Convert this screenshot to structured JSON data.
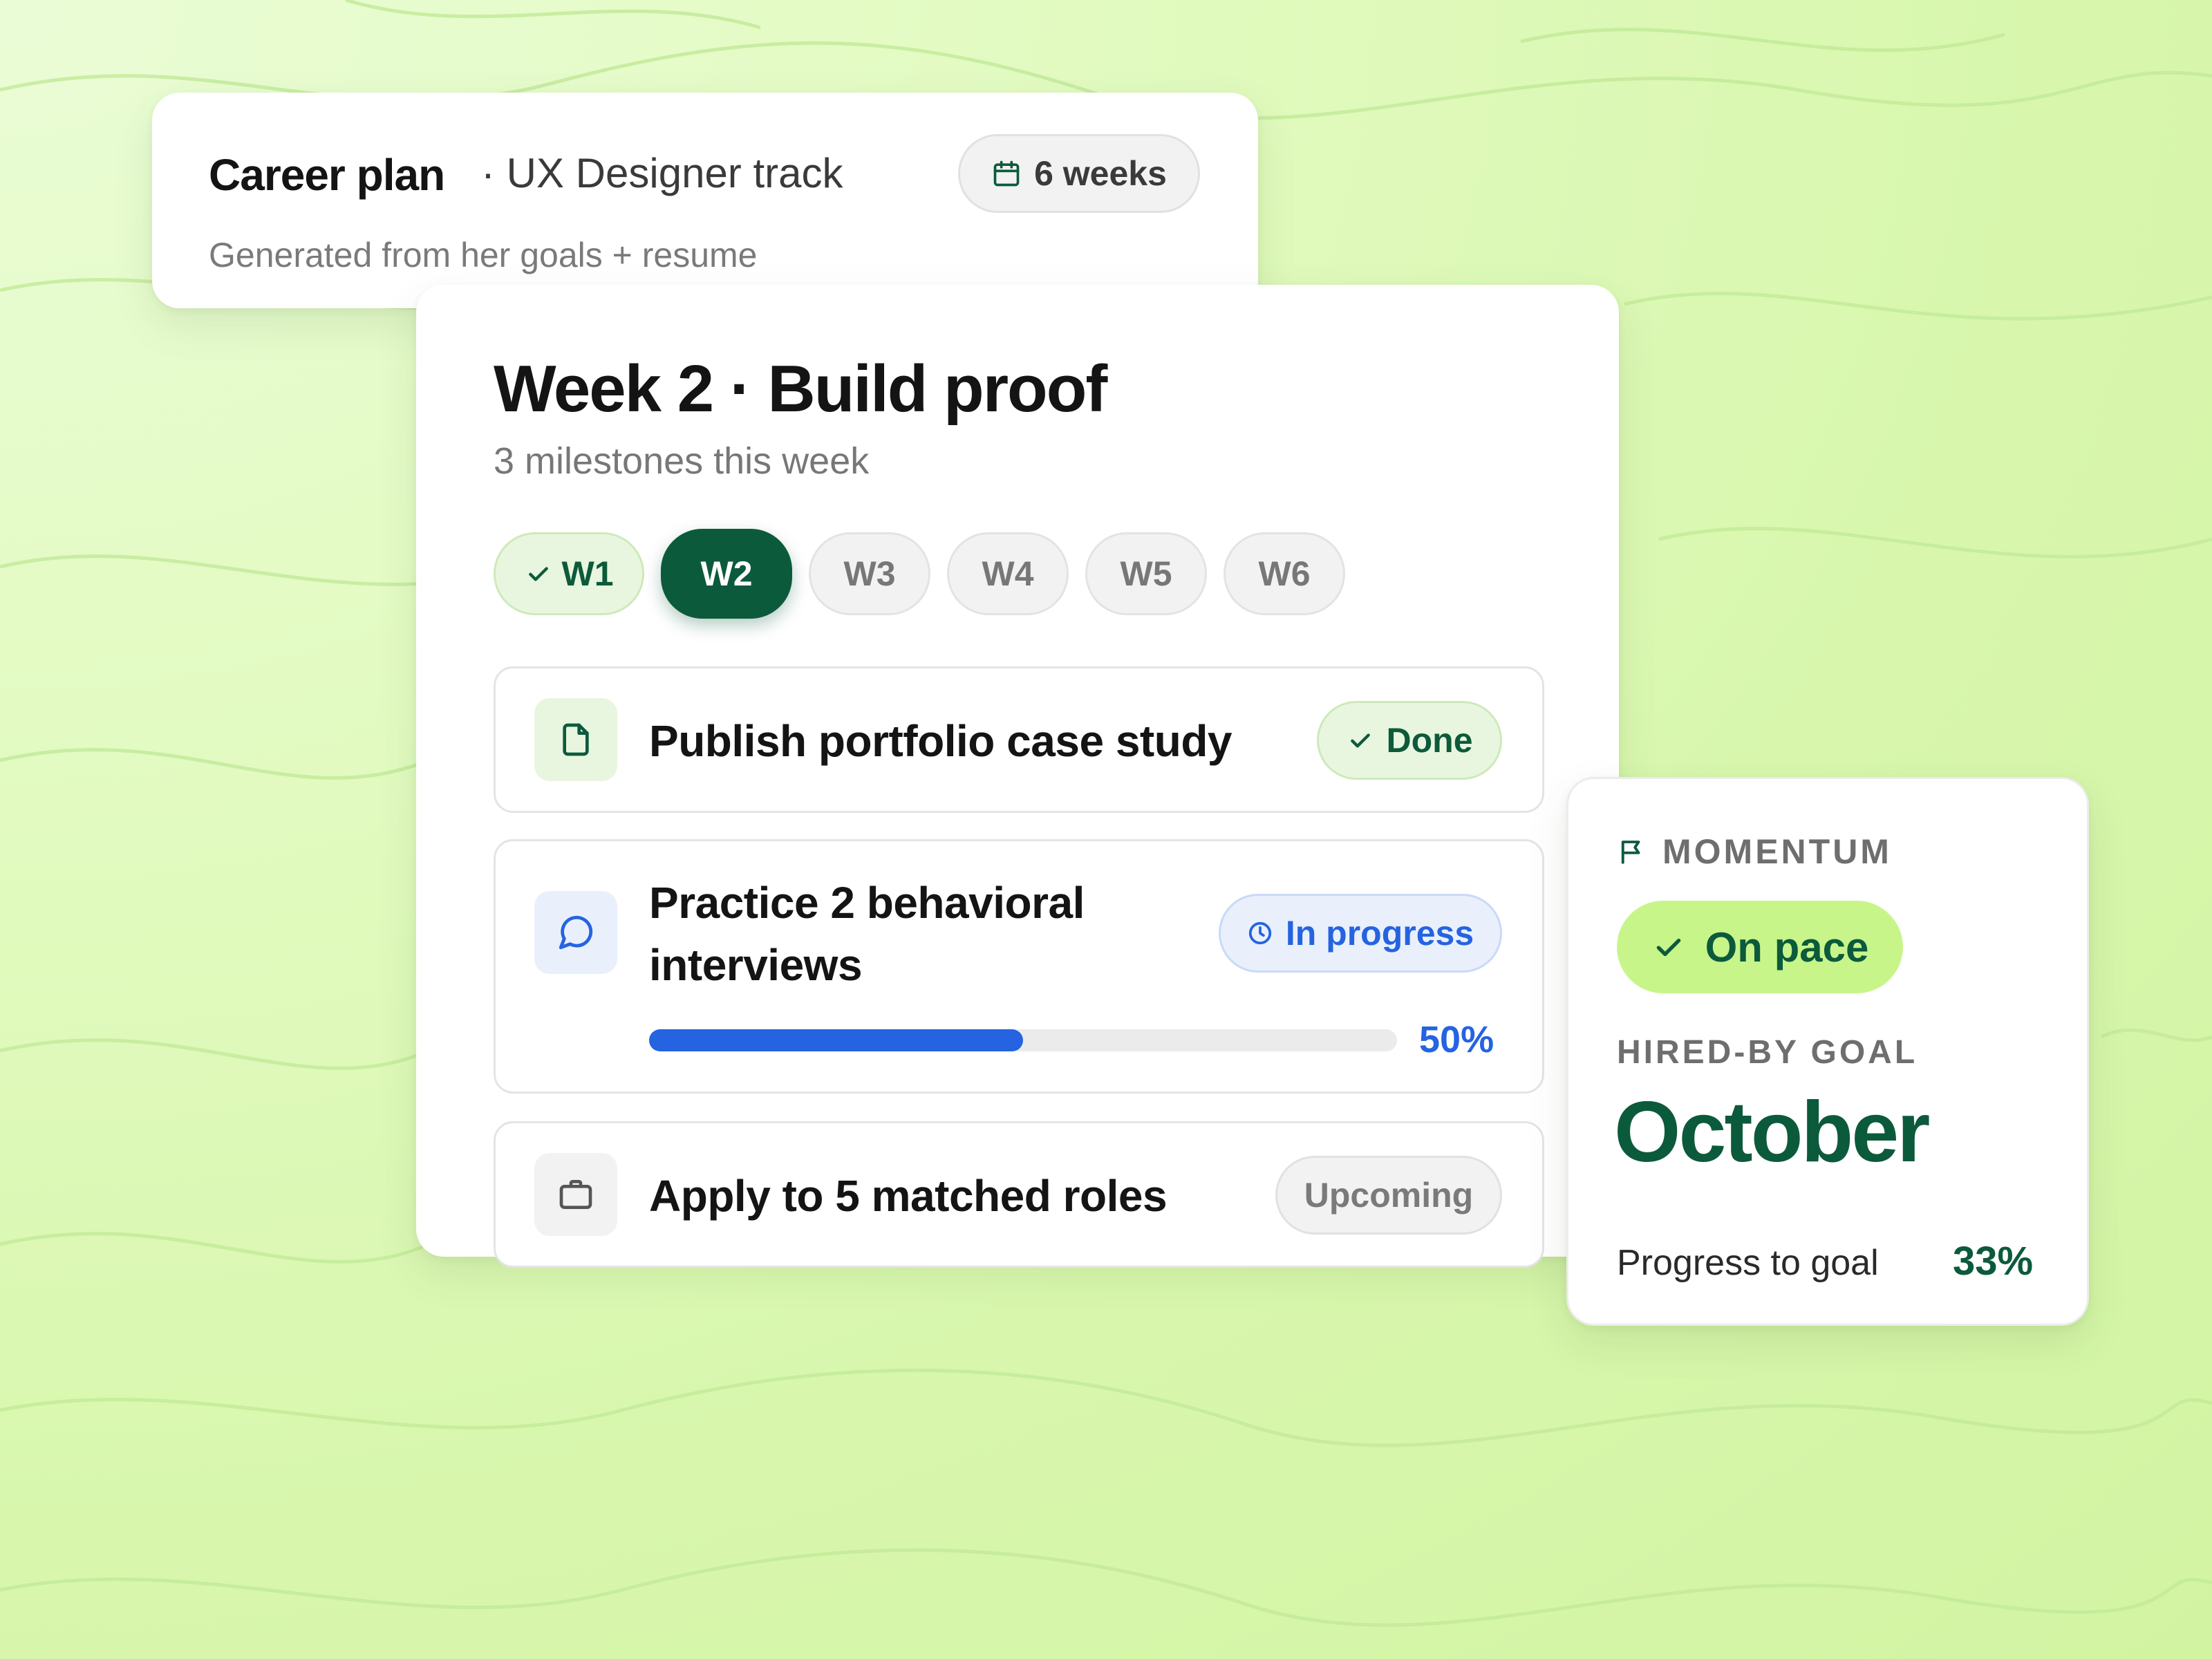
{
  "colors": {
    "brand_green": "#0c5a3c",
    "accent_lime": "#c7f58a",
    "progress_blue": "#2563e0",
    "background": "#d8f7ad"
  },
  "career_plan": {
    "title": "Career plan",
    "track": "· UX Designer track",
    "subtitle": "Generated from her goals + resume",
    "duration": "6 weeks",
    "duration_icon": "calendar-icon"
  },
  "week": {
    "title": "Week 2 · Build proof",
    "subtitle": "3 milestones this week",
    "tabs": [
      {
        "label": "W1",
        "state": "completed",
        "icon": "check-icon"
      },
      {
        "label": "W2",
        "state": "active"
      },
      {
        "label": "W3",
        "state": "upcoming"
      },
      {
        "label": "W4",
        "state": "upcoming"
      },
      {
        "label": "W5",
        "state": "upcoming"
      },
      {
        "label": "W6",
        "state": "upcoming"
      }
    ],
    "milestones": [
      {
        "title": "Publish portfolio case study",
        "status": "Done",
        "icon": "document-icon",
        "status_icon": "check-icon"
      },
      {
        "title": "Practice 2 behavioral interviews",
        "status": "In progress",
        "icon": "chat-bubble-icon",
        "status_icon": "clock-icon",
        "progress": 0.5,
        "progress_label": "50%"
      },
      {
        "title": "Apply to 5 matched roles",
        "status": "Upcoming",
        "icon": "briefcase-icon"
      }
    ]
  },
  "momentum": {
    "label": "MOMENTUM",
    "label_icon": "flag-icon",
    "status": "On pace",
    "status_icon": "check-icon",
    "hired_by_label": "HIRED-BY GOAL",
    "hired_by_value": "October",
    "progress_label": "Progress to goal",
    "progress_value": "33%"
  }
}
